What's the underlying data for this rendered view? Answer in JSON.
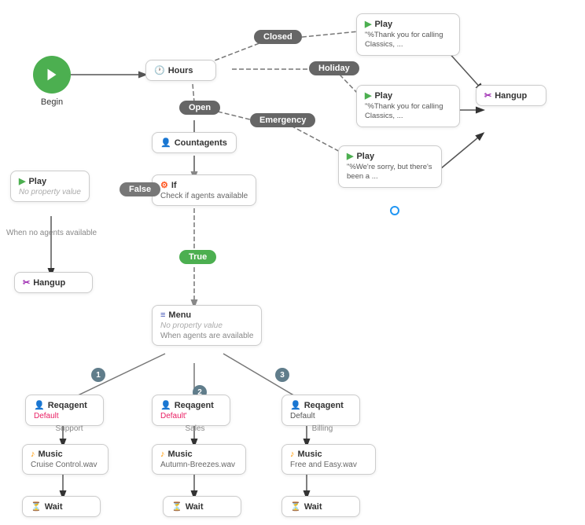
{
  "nodes": {
    "begin": {
      "label": "Begin"
    },
    "hours": {
      "label": "Hours"
    },
    "closed": {
      "label": "Closed"
    },
    "holiday": {
      "label": "Holiday"
    },
    "open": {
      "label": "Open"
    },
    "emergency": {
      "label": "Emergency"
    },
    "countagents": {
      "label": "Countagents"
    },
    "if": {
      "label": "If",
      "sub": "Check if agents available"
    },
    "true_pill": {
      "label": "True"
    },
    "false_pill": {
      "label": "False"
    },
    "play1": {
      "label": "Play",
      "value": "No property value"
    },
    "play_closed": {
      "label": "Play",
      "content": "\"%Thank you for calling Classics, ..."
    },
    "play_holiday": {
      "label": "Play",
      "content": "\"%Thank you for calling Classics, ..."
    },
    "play_emergency": {
      "label": "Play",
      "content": "\"%We're sorry, but there's been a ..."
    },
    "hangup1": {
      "label": "Hangup"
    },
    "hangup_right": {
      "label": "Hangup"
    },
    "menu": {
      "label": "Menu",
      "value": "No property value",
      "sub": "When agents are available"
    },
    "reqagent1": {
      "label": "Reqagent",
      "sub": "Default",
      "footer": "Support"
    },
    "reqagent2": {
      "label": "Reqagent",
      "sub": "Default'",
      "footer": "Sales"
    },
    "reqagent3": {
      "label": "Reqagent",
      "sub": "Default",
      "footer": "Billing"
    },
    "music1": {
      "label": "Music",
      "sub": "Cruise Control.wav"
    },
    "music2": {
      "label": "Music",
      "sub": "Autumn-Breezes.wav"
    },
    "music3": {
      "label": "Music",
      "sub": "Free and Easy.wav"
    },
    "wait1": {
      "label": "Wait"
    },
    "wait2": {
      "label": "Wait"
    },
    "wait3": {
      "label": "Wait"
    },
    "no_agents_label": {
      "label": "When no agents available"
    }
  }
}
